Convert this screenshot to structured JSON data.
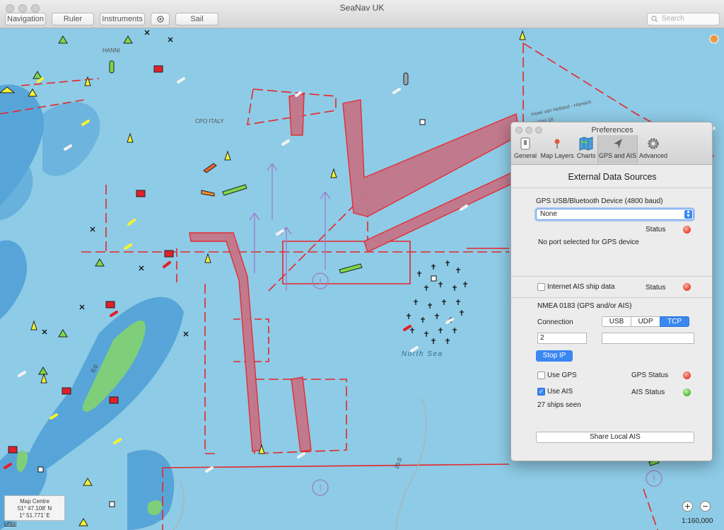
{
  "window": {
    "title": "SeaNav UK"
  },
  "toolbar": {
    "navigation": "Navigation",
    "ruler": "Ruler",
    "instruments": "Instruments",
    "sail": "Sail",
    "search_placeholder": "Search"
  },
  "map": {
    "labels": {
      "hanni": "HANNI",
      "cpo_italy": "CPO ITALY",
      "north_sea": "North Sea",
      "hoek_harwich": "Hoek van Holland - Harwich",
      "krm": "KRM-18",
      "depth_0": "0.0",
      "depth_20": "20.0"
    },
    "map_centre": {
      "label": "Map Centre",
      "lat": "51° 47.108' N",
      "lon": "1° 51.771' E"
    },
    "legal": "Legal",
    "scale": "1:160,000",
    "zoom_in": "+",
    "zoom_out": "−"
  },
  "preferences": {
    "title": "Preferences",
    "tabs": [
      "General",
      "Map Layers",
      "Charts",
      "GPS and AIS",
      "Advanced"
    ],
    "selected_tab": "GPS and AIS",
    "heading": "External Data Sources",
    "gps_device_label": "GPS USB/Bluetooth Device (4800 baud)",
    "gps_device_value": "None",
    "status_label": "Status",
    "gps_device_status": "red",
    "no_port_message": "No port selected for GPS device",
    "internet_ais_label": "Internet AIS ship data",
    "internet_ais_checked": false,
    "internet_ais_status": "red",
    "nmea_label": "NMEA 0183 (GPS and/or AIS)",
    "connection_label": "Connection",
    "connection_options": [
      "USB",
      "UDP",
      "TCP"
    ],
    "connection_selected": "TCP",
    "field_port": "2",
    "field_host": "",
    "stop_ip_label": "Stop IP",
    "use_gps_label": "Use GPS",
    "use_gps_checked": false,
    "gps_status_label": "GPS Status",
    "gps_status": "red",
    "use_ais_label": "Use AIS",
    "use_ais_checked": true,
    "ais_status_label": "AIS Status",
    "ais_status": "green",
    "ships_seen": "27 ships seen",
    "share_local_ais_label": "Share Local AIS"
  },
  "colors": {
    "sea": "#8ecbe6",
    "shallow": "#3f94cf",
    "land_green": "#7fcf7a",
    "lane": "#e8262a",
    "accent": "#3a87f0"
  }
}
